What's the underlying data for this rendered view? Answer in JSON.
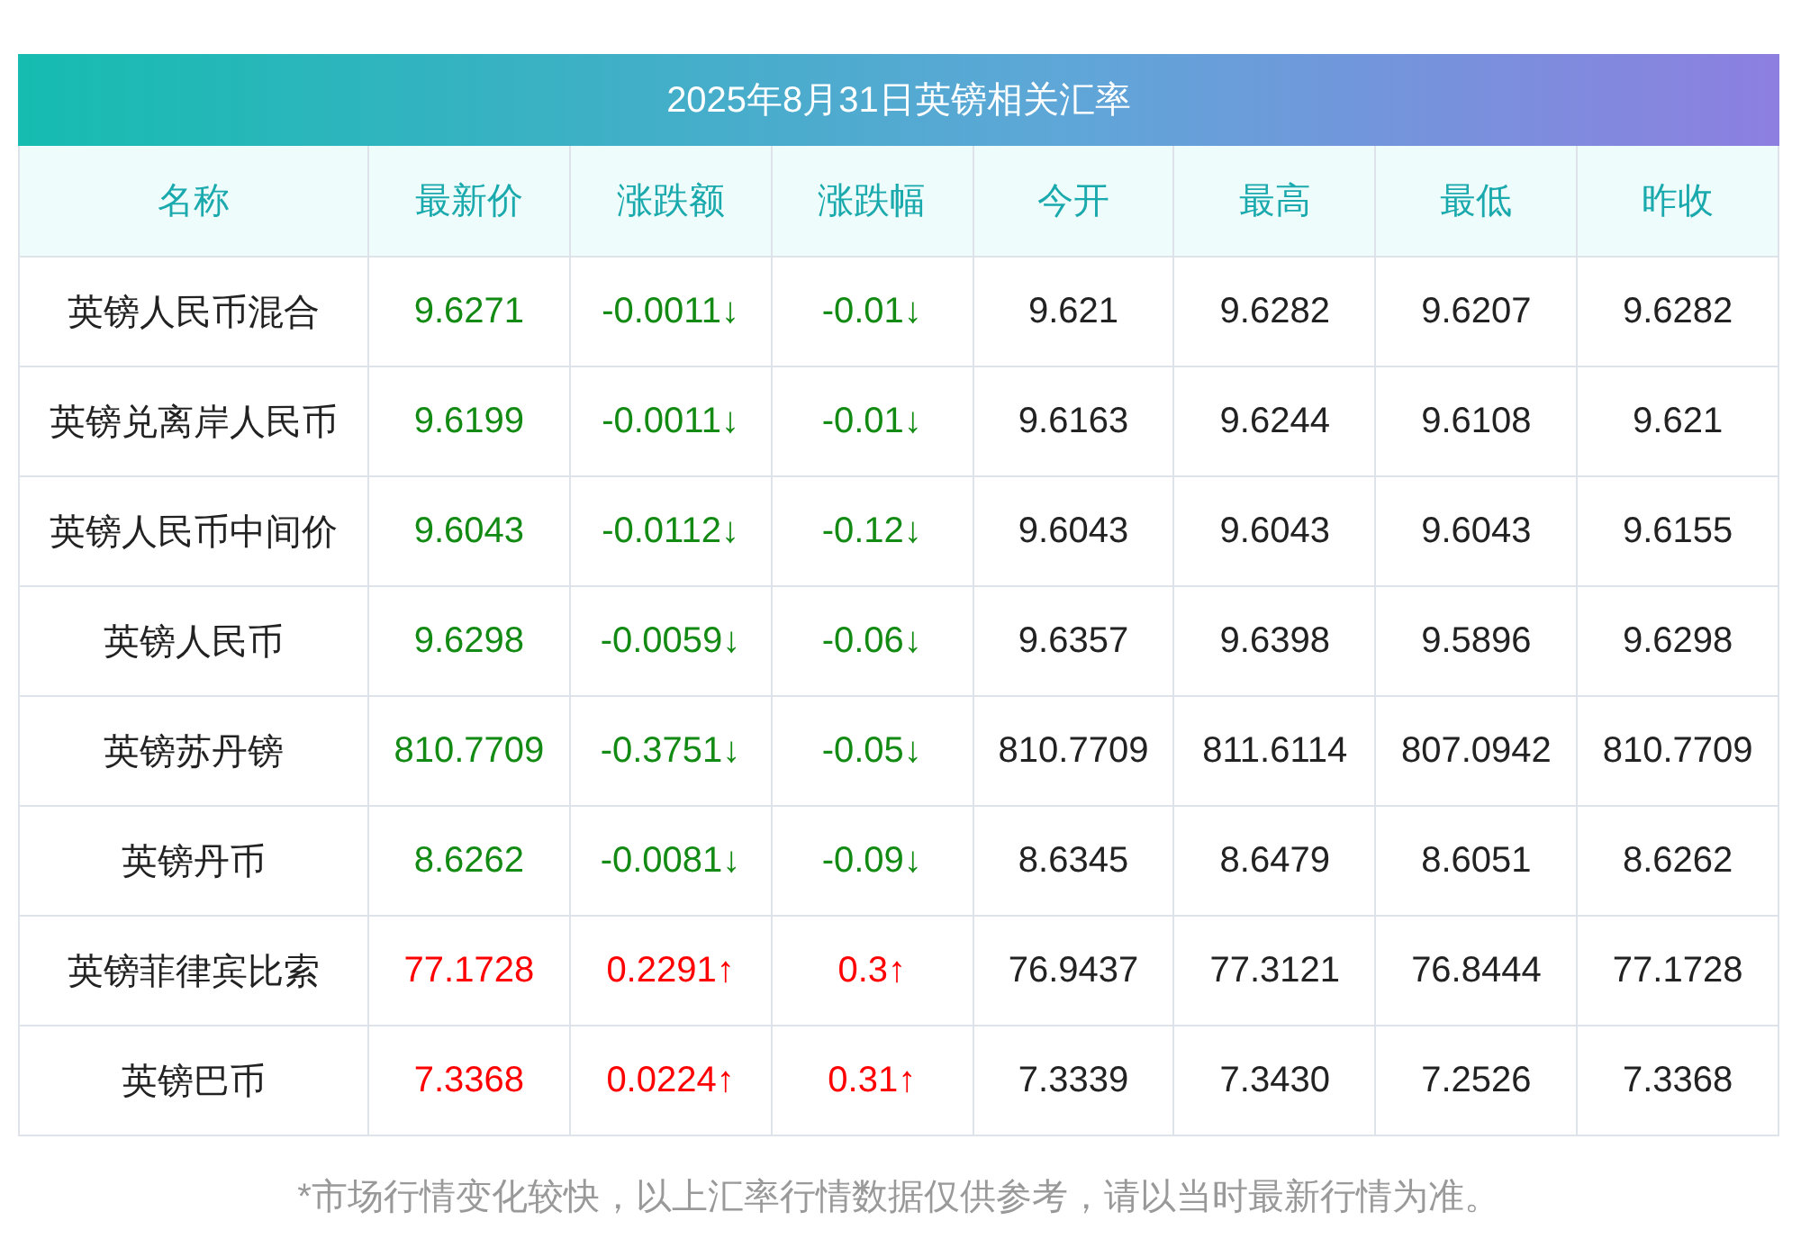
{
  "title": "2025年8月31日英镑相关汇率",
  "columns": [
    "名称",
    "最新价",
    "涨跌额",
    "涨跌幅",
    "今开",
    "最高",
    "最低",
    "昨收"
  ],
  "rows": [
    {
      "kind": "down",
      "cells": [
        "英镑人民币混合",
        "9.6271",
        "-0.0011↓",
        "-0.01↓",
        "9.621",
        "9.6282",
        "9.6207",
        "9.6282"
      ]
    },
    {
      "kind": "down",
      "cells": [
        "英镑兑离岸人民币",
        "9.6199",
        "-0.0011↓",
        "-0.01↓",
        "9.6163",
        "9.6244",
        "9.6108",
        "9.621"
      ]
    },
    {
      "kind": "down",
      "cells": [
        "英镑人民币中间价",
        "9.6043",
        "-0.0112↓",
        "-0.12↓",
        "9.6043",
        "9.6043",
        "9.6043",
        "9.6155"
      ]
    },
    {
      "kind": "down",
      "cells": [
        "英镑人民币",
        "9.6298",
        "-0.0059↓",
        "-0.06↓",
        "9.6357",
        "9.6398",
        "9.5896",
        "9.6298"
      ]
    },
    {
      "kind": "down",
      "cells": [
        "英镑苏丹镑",
        "810.7709",
        "-0.3751↓",
        "-0.05↓",
        "810.7709",
        "811.6114",
        "807.0942",
        "810.7709"
      ]
    },
    {
      "kind": "down",
      "cells": [
        "英镑丹币",
        "8.6262",
        "-0.0081↓",
        "-0.09↓",
        "8.6345",
        "8.6479",
        "8.6051",
        "8.6262"
      ]
    },
    {
      "kind": "up",
      "cells": [
        "英镑菲律宾比索",
        "77.1728",
        "0.2291↑",
        "0.3↑",
        "76.9437",
        "77.3121",
        "76.8444",
        "77.1728"
      ]
    },
    {
      "kind": "up",
      "cells": [
        "英镑巴币",
        "7.3368",
        "0.0224↑",
        "0.31↑",
        "7.3339",
        "7.3430",
        "7.2526",
        "7.3368"
      ]
    }
  ],
  "footnote": "*市场行情变化较快，以上汇率行情数据仅供参考，请以当时最新行情为准。"
}
